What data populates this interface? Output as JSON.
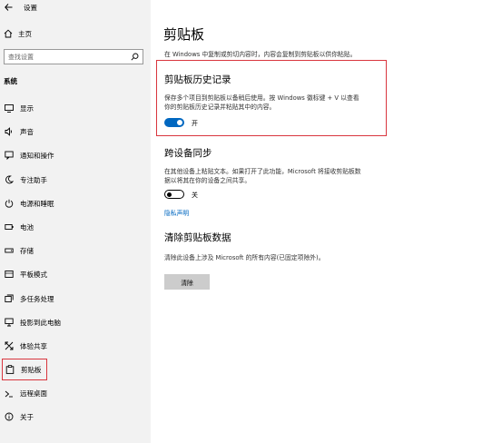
{
  "window": {
    "title": "设置"
  },
  "sidebar": {
    "home_label": "主页",
    "search_placeholder": "查找设置",
    "section_label": "系统",
    "items": [
      {
        "label": "显示",
        "icon": "display-icon"
      },
      {
        "label": "声音",
        "icon": "sound-icon"
      },
      {
        "label": "通知和操作",
        "icon": "notifications-icon"
      },
      {
        "label": "专注助手",
        "icon": "focus-assist-icon"
      },
      {
        "label": "电源和睡眠",
        "icon": "power-icon"
      },
      {
        "label": "电池",
        "icon": "battery-icon"
      },
      {
        "label": "存储",
        "icon": "storage-icon"
      },
      {
        "label": "平板模式",
        "icon": "tablet-icon"
      },
      {
        "label": "多任务处理",
        "icon": "multitasking-icon"
      },
      {
        "label": "投影到此电脑",
        "icon": "project-icon"
      },
      {
        "label": "体验共享",
        "icon": "shared-experiences-icon"
      },
      {
        "label": "剪贴板",
        "icon": "clipboard-icon",
        "selected": true
      },
      {
        "label": "远程桌面",
        "icon": "remote-desktop-icon"
      },
      {
        "label": "关于",
        "icon": "info-icon"
      }
    ]
  },
  "main": {
    "title": "剪贴板",
    "description": "在 Windows 中复制或剪切内容时，内容会复制到剪贴板以供你粘贴。",
    "history": {
      "heading": "剪贴板历史记录",
      "desc_line1": "保存多个项目到剪贴板以备稍后使用。按 Windows 徽标键 + V 以查看",
      "desc_line2": "你的剪贴板历史记录并粘贴其中的内容。",
      "toggle_label": "开",
      "toggle_on": true
    },
    "sync": {
      "heading": "跨设备同步",
      "desc_line1": "在其他设备上粘贴文本。如果打开了此功能，Microsoft 将接收剪贴板数",
      "desc_line2": "据以将其在你的设备之间共享。",
      "toggle_label": "关",
      "toggle_on": false,
      "privacy_link": "隐私声明"
    },
    "clear": {
      "heading": "清除剪贴板数据",
      "desc": "清除此设备上涉及 Microsoft 的所有内容(已固定项除外)。",
      "button_label": "清除"
    }
  },
  "colors": {
    "accent": "#0067c0",
    "highlight_border": "#d9363e",
    "sidebar_bg": "#f2f2f2"
  }
}
